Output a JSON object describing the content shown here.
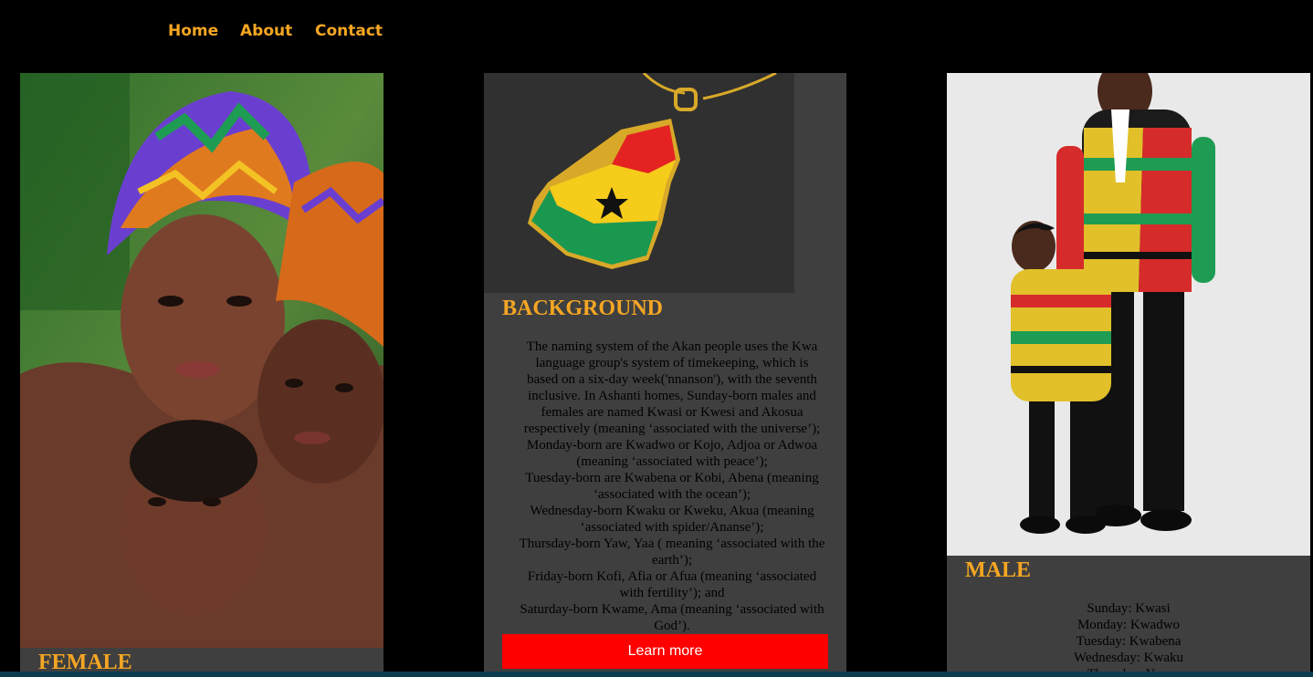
{
  "nav": {
    "home": "Home",
    "about": "About",
    "contact": "Contact"
  },
  "colors": {
    "accent": "#f5a623",
    "card": "#3f3f3f",
    "button": "#ff0000"
  },
  "female": {
    "heading": "FEMALE"
  },
  "background": {
    "heading": "BACKGROUND",
    "lines": [
      "The naming system of the Akan people uses the Kwa",
      "language group's system of timekeeping, which is",
      "based on a six-day week('nnanson'), with the seventh",
      "inclusive. In Ashanti homes, Sunday-born males and",
      "females are named Kwasi or Kwesi and Akosua",
      "respectively (meaning ‘associated with the universe’);",
      "Monday-born are Kwadwo or Kojo, Adjoa or Adwoa",
      "(meaning ‘associated with peace’);",
      "Tuesday-born are Kwabena or Kobi, Abena (meaning",
      "‘associated with the ocean’);",
      "Wednesday-born Kwaku or Kweku, Akua (meaning",
      "‘associated with spider/Ananse’);",
      "Thursday-born Yaw, Yaa ( meaning ‘associated with the",
      "earth’);",
      "Friday-born Kofi, Afia or Afua (meaning ‘associated",
      "with fertility’); and",
      "Saturday-born Kwame, Ama (meaning ‘associated with",
      "God’)."
    ],
    "button_label": "Learn more"
  },
  "male": {
    "heading": "MALE",
    "days": [
      "Sunday: Kwasi",
      "Monday: Kwadwo",
      "Tuesday: Kwabena",
      "Wednesday: Kwaku",
      "Thursday: Yaw"
    ]
  }
}
